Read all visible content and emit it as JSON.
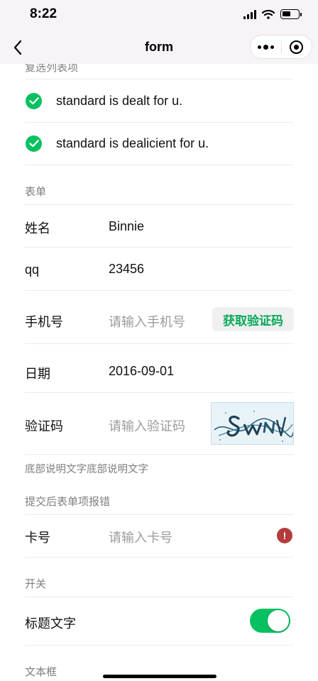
{
  "status_bar": {
    "time": "8:22"
  },
  "nav": {
    "title": "form"
  },
  "checkbox_section": {
    "title": "复选列表项",
    "items": [
      {
        "label": "standard is dealt for u.",
        "checked": true
      },
      {
        "label": "standard is dealicient for u.",
        "checked": true
      }
    ]
  },
  "form_section": {
    "title": "表单",
    "name_label": "姓名",
    "name_value": "Binnie",
    "qq_label": "qq",
    "qq_value": "23456",
    "phone_label": "手机号",
    "phone_placeholder": "请输入手机号",
    "get_code_button": "获取验证码",
    "date_label": "日期",
    "date_value": "2016-09-01",
    "captcha_label": "验证码",
    "captcha_placeholder": "请输入验证码",
    "footer_note": "底部说明文字底部说明文字"
  },
  "error_section": {
    "title": "提交后表单项报错",
    "card_label": "卡号",
    "card_placeholder": "请输入卡号"
  },
  "switch_section": {
    "title": "开关",
    "switch_label": "标题文字",
    "switch_on": true
  },
  "textarea_section": {
    "title": "文本框"
  },
  "colors": {
    "accent": "#07c160",
    "error": "#b53c3c",
    "nav_background": "#f7f3f7"
  }
}
